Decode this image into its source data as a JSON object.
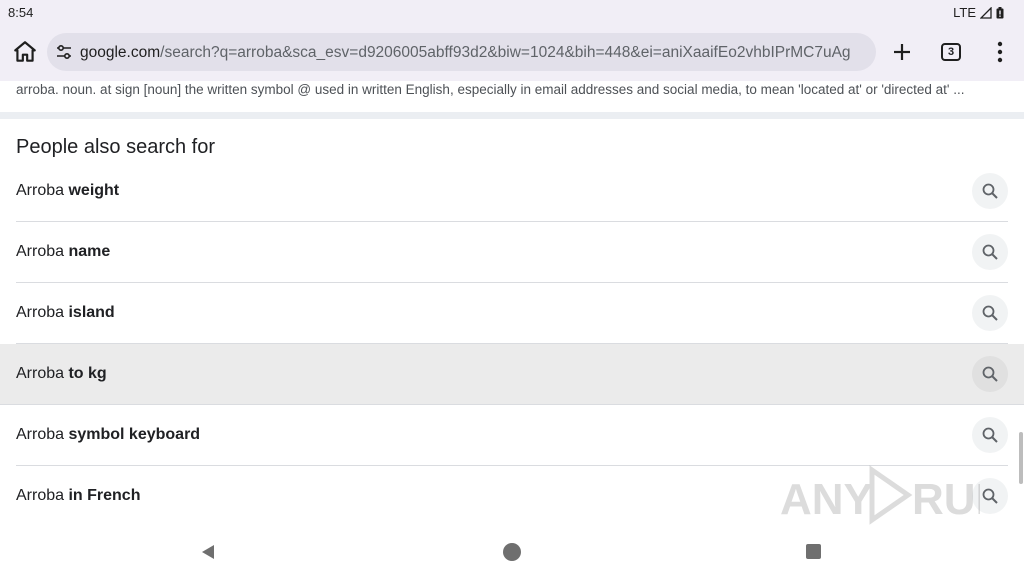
{
  "status": {
    "time": "8:54",
    "network": "LTE"
  },
  "toolbar": {
    "url_host": "google.com",
    "url_path": "/search?q=arroba&sca_esv=d9206005abff93d2&biw=1024&bih=448&ei=aniXaaifEo2vhbIPrMC7uAg",
    "tab_count": "3"
  },
  "snippet": {
    "text": "arroba. noun. at sign [noun] the written symbol @ used in written English, especially in email addresses and social media, to mean 'located at' or 'directed at' ..."
  },
  "pasf": {
    "heading": "People also search for",
    "items": [
      {
        "prefix": "Arroba ",
        "bold": "weight"
      },
      {
        "prefix": "Arroba ",
        "bold": "name"
      },
      {
        "prefix": "Arroba ",
        "bold": "island"
      },
      {
        "prefix": "Arroba ",
        "bold": "to kg"
      },
      {
        "prefix": "Arroba ",
        "bold": "symbol keyboard"
      },
      {
        "prefix": "Arroba ",
        "bold": "in French"
      }
    ]
  },
  "watermark": {
    "text": "ANY RUN"
  },
  "icons": {
    "home": "home-icon",
    "tune": "tune-icon",
    "new_tab": "plus-icon",
    "menu": "more-vert-icon",
    "search": "search-icon",
    "back": "back-triangle-icon",
    "nav_home": "circle-home-icon",
    "recents": "square-recents-icon"
  },
  "colors": {
    "toolbar_bg": "#f1eef6",
    "url_bar_bg": "#e2e0ea",
    "highlight_row": "#ebebeb"
  }
}
